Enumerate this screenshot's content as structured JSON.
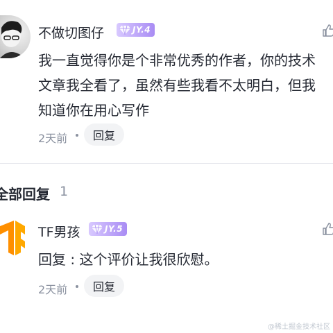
{
  "main_comment": {
    "username": "不做切图仔",
    "level_badge": "JY.4",
    "text_lines": [
      "我一直觉得你是个非常优秀的作者，你的技术",
      "文章我全看了，虽然有些我看不太明白，但我",
      "知道你在用心写作"
    ],
    "time": "2天前",
    "reply_label": "回复"
  },
  "replies_section": {
    "title": "全部回复",
    "count": "1"
  },
  "reply": {
    "username": "TF男孩",
    "level_badge": "JY.5",
    "text": "回复 : 这个评价让我很欣慰。",
    "time": "2天前",
    "reply_label": "回复"
  },
  "watermark": "@稀土掘金技术社区",
  "colors": {
    "text_primary": "#252933",
    "text_secondary": "#8a919f",
    "badge_start": "#d8c9ff",
    "badge_end": "#a98cf4",
    "reply_button_bg": "#f2f3f5",
    "tf_orange": "#ff8f00"
  },
  "icons": [
    "user-avatar",
    "diamond-gem-icon",
    "thumbs-up-icon",
    "tensorflow-logo-avatar"
  ]
}
